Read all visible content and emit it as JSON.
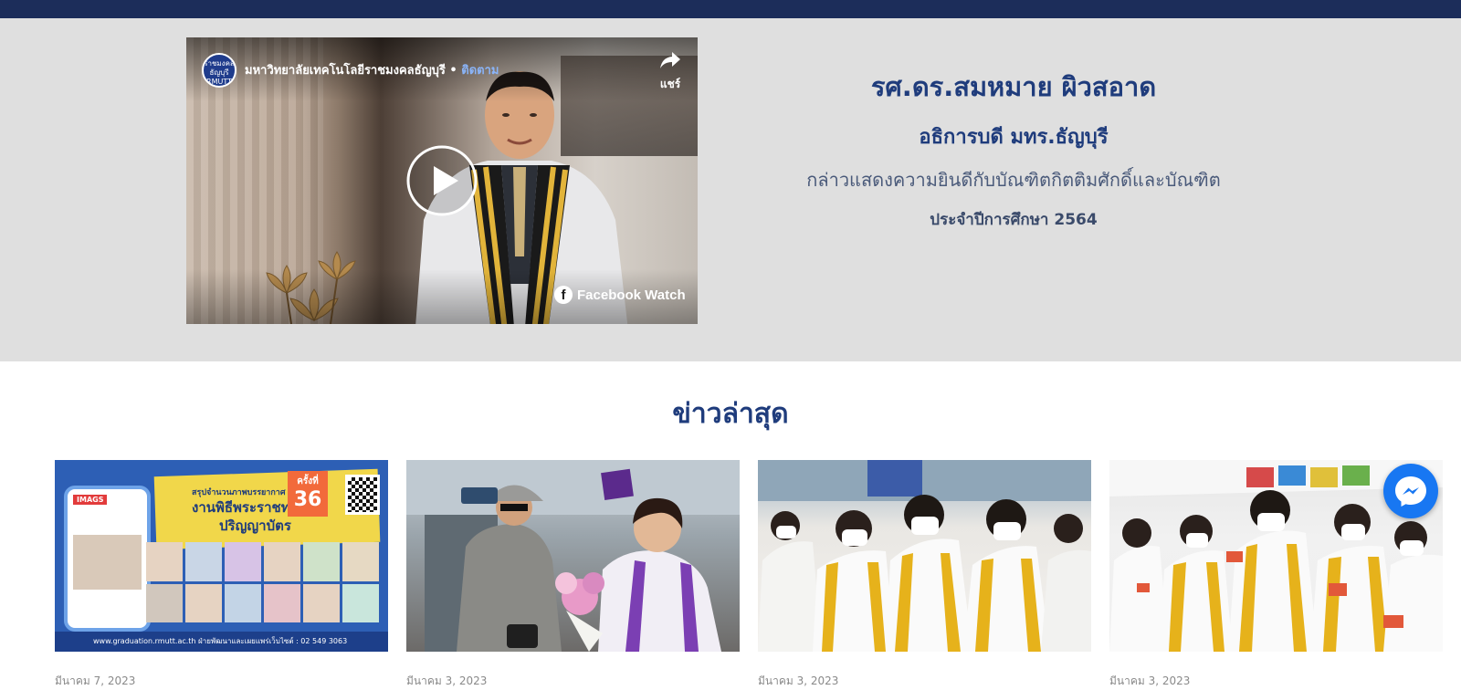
{
  "video": {
    "page_name": "มหาวิทยาลัยเทคโนโลยีราชมงคลธัญบุรี",
    "separator": " • ",
    "follow_label": "ติดตาม",
    "share_label": "แชร์",
    "avatar_text": "ราชมงคล ธัญบุรี RMUTT",
    "watch_label": "Facebook Watch"
  },
  "hero": {
    "name": "รศ.ดร.สมหมาย ผิวสอาด",
    "role": "อธิการบดี มทร.ธัญบุรี",
    "description": "กล่าวแสดงความยินดีกับบัณฑิตกิตติมศักดิ์และบัณฑิต",
    "year": "ประจำปีการศึกษา 2564"
  },
  "news": {
    "title": "ข่าวล่าสุด",
    "thumb1": {
      "tag": "IMAGS",
      "banner_line1": "สรุปจำนวนภาพบรรยากาศ",
      "banner_line2": "งานพิธีพระราชทาน",
      "banner_line3": "ปริญญาบัตร",
      "badge_label": "ครั้งที่",
      "badge_number": "36",
      "footer": "www.graduation.rmutt.ac.th    ฝ่ายพัฒนาและเผยแพร่เว็บไซต์ : 02 549 3063"
    },
    "items": [
      {
        "date": "มีนาคม 7, 2023"
      },
      {
        "date": "มีนาคม 3, 2023"
      },
      {
        "date": "มีนาคม 3, 2023"
      },
      {
        "date": "มีนาคม 3, 2023"
      }
    ]
  },
  "colors": {
    "navy": "#1c2d5a",
    "heading_blue": "#1f3c7c",
    "hero_bg": "#dfdfdf",
    "messenger_blue": "#1877f2"
  }
}
